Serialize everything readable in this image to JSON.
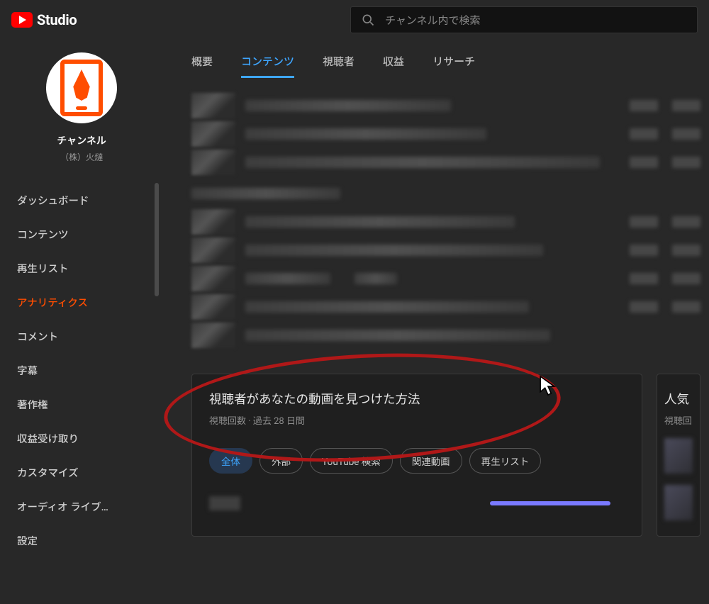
{
  "header": {
    "logo_text": "Studio",
    "search_placeholder": "チャンネル内で検索"
  },
  "sidebar": {
    "channel_label": "チャンネル",
    "channel_name": "（株）火燵",
    "items": [
      {
        "label": "ダッシュボード"
      },
      {
        "label": "コンテンツ"
      },
      {
        "label": "再生リスト"
      },
      {
        "label": "アナリティクス"
      },
      {
        "label": "コメント"
      },
      {
        "label": "字幕"
      },
      {
        "label": "著作権"
      },
      {
        "label": "収益受け取り"
      },
      {
        "label": "カスタマイズ"
      },
      {
        "label": "オーディオ ライブ…"
      },
      {
        "label": "設定"
      }
    ],
    "active_index": 3
  },
  "tabs": {
    "items": [
      {
        "label": "概要"
      },
      {
        "label": "コンテンツ"
      },
      {
        "label": "視聴者"
      },
      {
        "label": "収益"
      },
      {
        "label": "リサーチ"
      }
    ],
    "active_index": 1
  },
  "discovery_card": {
    "title": "視聴者があなたの動画を見つけた方法",
    "subtitle": "視聴回数 · 過去 28 日間",
    "chips": [
      {
        "label": "全体",
        "active": true
      },
      {
        "label": "外部"
      },
      {
        "label": "YouTube 検索"
      },
      {
        "label": "関連動画"
      },
      {
        "label": "再生リスト"
      }
    ]
  },
  "side_card": {
    "title_fragment": "人気",
    "subtitle_fragment": "視聴回"
  },
  "colors": {
    "accent_red": "#ff0000",
    "accent_orange": "#ff4d00",
    "accent_blue": "#3ea6ff",
    "bar_purple": "#7a7aff",
    "annotation_red": "#b01818"
  }
}
